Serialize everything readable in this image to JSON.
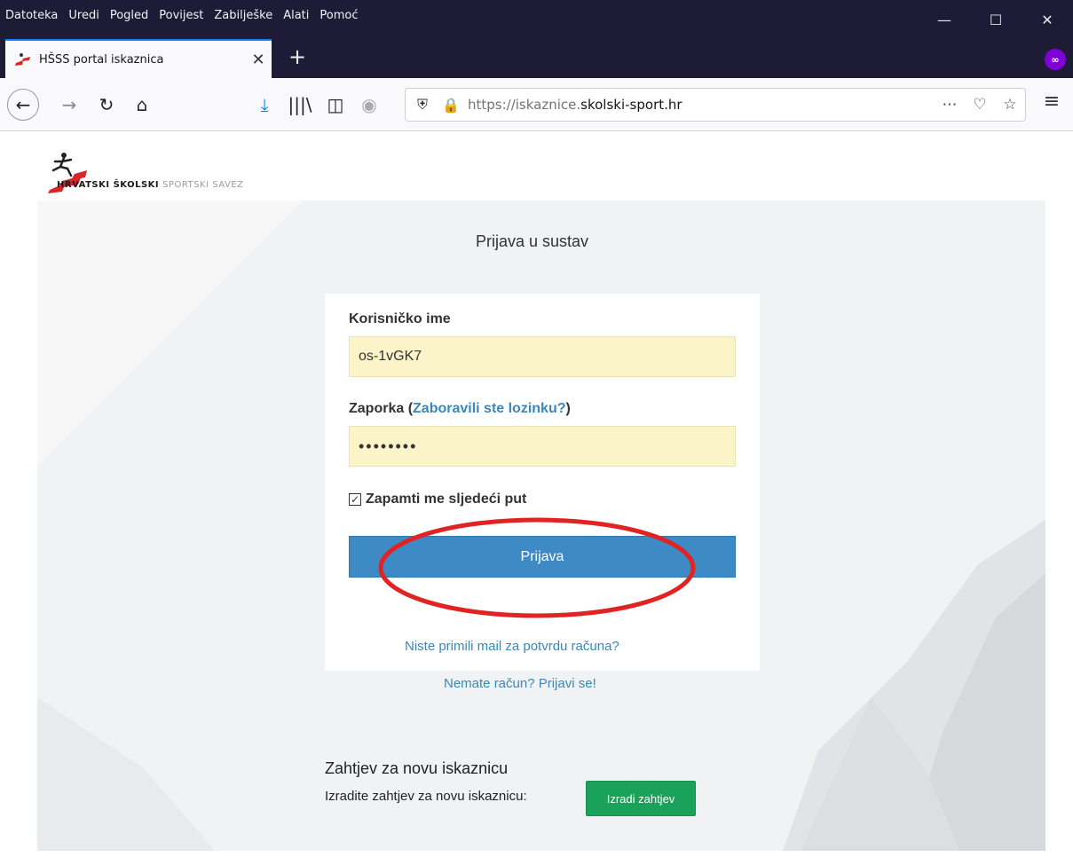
{
  "browser": {
    "menu": [
      "Datoteka",
      "Uredi",
      "Pogled",
      "Povijest",
      "Zabilješke",
      "Alati",
      "Pomoć"
    ],
    "tab_title": "HŠSS portal iskaznica",
    "url_prefix": "https://iskaznice.",
    "url_domain": "skolski-sport.hr",
    "private_badge": "∞"
  },
  "logo": {
    "text_bold": "HRVATSKI ŠKOLSKI",
    "text_light": "SPORTSKI SAVEZ"
  },
  "login": {
    "title": "Prijava u sustav",
    "username_label": "Korisničko ime",
    "username_value": "os-1vGK7",
    "password_label": "Zaporka (",
    "forgot_link": "Zaboravili ste lozinku?",
    "password_label_end": ")",
    "password_value": "••••••••",
    "remember_label": "Zapamti me sljedeći put",
    "remember_checked": true,
    "submit_label": "Prijava"
  },
  "links": {
    "resend_confirmation": "Niste primili mail za potvrdu računa?",
    "register": "Nemate račun? Prijavi se!"
  },
  "new_card": {
    "title": "Zahtjev za novu iskaznicu",
    "text": "Izradite zahtjev za novu iskaznicu:",
    "button_label": "Izradi zahtjev"
  },
  "colors": {
    "primary_button": "#3e8ac4",
    "success_button": "#1aa25a",
    "link": "#3a87b8",
    "autofill_bg": "#faf4c8",
    "annotation_ellipse": "#e02424"
  }
}
